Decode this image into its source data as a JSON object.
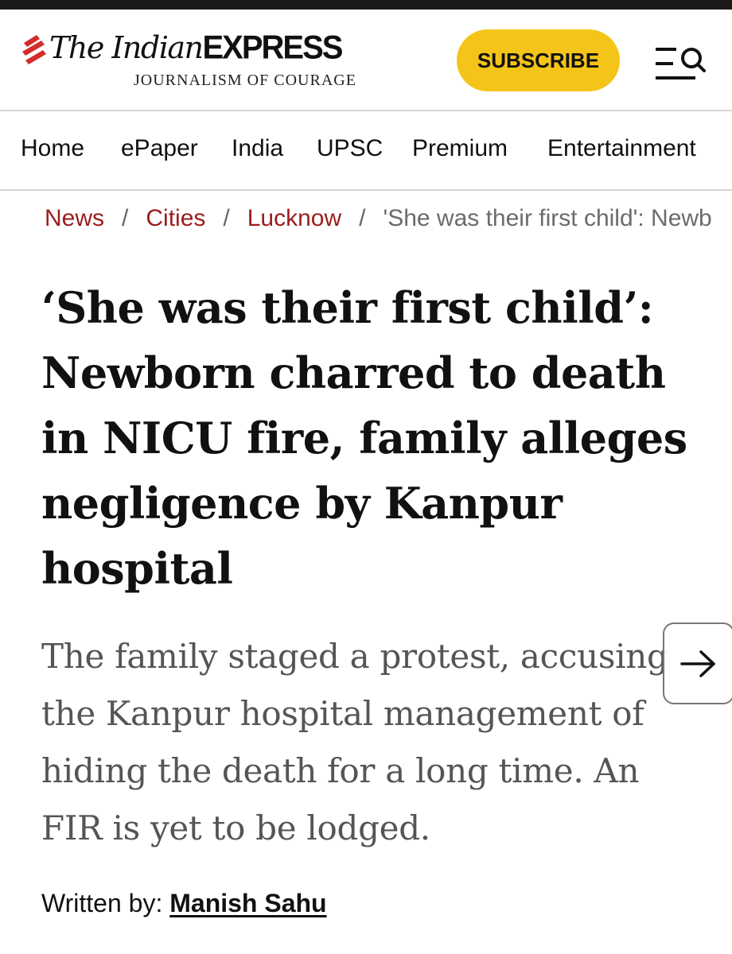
{
  "header": {
    "logo": {
      "name_prefix": "The Indian",
      "name_suffix": "EXPRESS",
      "tagline": "JOURNALISM OF COURAGE"
    },
    "subscribe_label": "SUBSCRIBE",
    "icons": {
      "menu": "hamburger-menu-icon",
      "search": "search-icon"
    }
  },
  "nav": {
    "items": [
      {
        "label": "Home"
      },
      {
        "label": "ePaper"
      },
      {
        "label": "India"
      },
      {
        "label": "UPSC"
      },
      {
        "label": "Premium"
      },
      {
        "label": "Entertainment"
      }
    ]
  },
  "breadcrumb": {
    "items": [
      "News",
      "Cities",
      "Lucknow"
    ],
    "separator": "/",
    "current": "'She was their first child': Newborn charred to death in NICU fire, family alleges negligence by Kanpur hospital"
  },
  "article": {
    "headline": "‘She was their first child’: Newborn charred to death in NICU fire, family alleges negligence by Kanpur hospital",
    "summary": "The family staged a protest, accusing the Kanpur hospital management of hiding the death for a long time. An FIR is yet to be lodged.",
    "byline_prefix": "Written by:",
    "author": "Manish Sahu"
  },
  "colors": {
    "subscribe_bg": "#f4c518",
    "breadcrumb_link": "#9b1c1c",
    "logo_mark": "#d42b2b",
    "summary_text": "#555555"
  }
}
